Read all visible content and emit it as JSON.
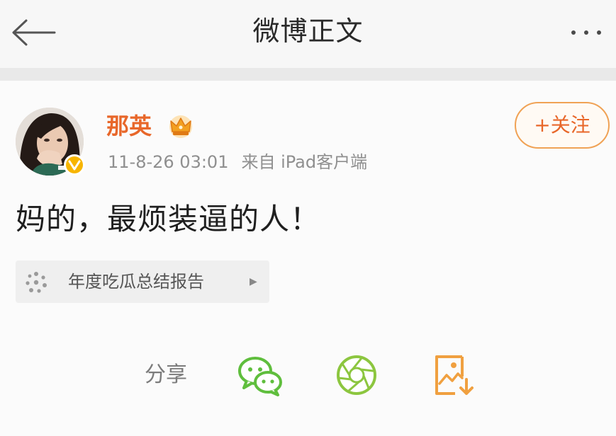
{
  "header": {
    "title": "微博正文",
    "back_icon": "arrow-left-icon",
    "more_icon": "more-dots-icon"
  },
  "post": {
    "author": {
      "name": "那英",
      "avatar_icon": "avatar-photo",
      "verified_icon": "verified-v-badge-icon",
      "crown_icon": "crown-icon"
    },
    "timestamp": "11-8-26 03:01",
    "source": "来自 iPad客户端",
    "text": "妈的，最烦装逼的人！",
    "follow_button": "+关注",
    "topic": {
      "label": "年度吃瓜总结报告",
      "icon": "sparkle-dots-icon",
      "arrow_icon": "triangle-right-icon"
    }
  },
  "share": {
    "label": "分享",
    "targets": [
      {
        "name": "wechat",
        "icon": "wechat-icon"
      },
      {
        "name": "moments",
        "icon": "wechat-moments-icon"
      },
      {
        "name": "save-image",
        "icon": "save-image-icon"
      }
    ]
  },
  "colors": {
    "brand_orange": "#e8672a",
    "follow_border": "#f0a255",
    "wechat_green": "#5fbe3d",
    "moments_green": "#8cc63f",
    "save_orange": "#f0a040"
  }
}
